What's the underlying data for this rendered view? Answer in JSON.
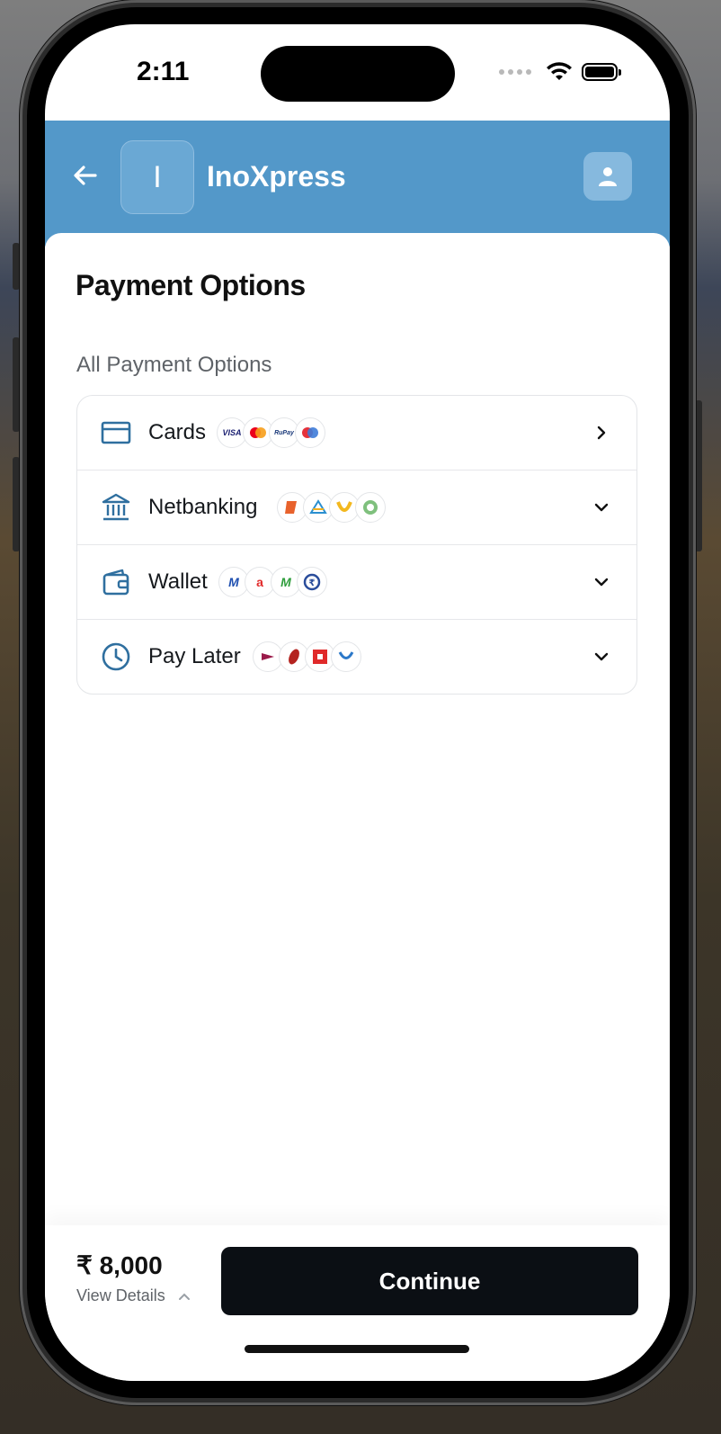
{
  "status_bar": {
    "time": "2:11"
  },
  "header": {
    "logo_letter": "I",
    "brand": "InoXpress"
  },
  "page": {
    "title": "Payment Options",
    "section_label": "All Payment Options"
  },
  "payment_options": [
    {
      "label": "Cards",
      "icon": "credit-card-icon",
      "chevron": "chevron-right-icon",
      "logos": [
        "VISA",
        "Mastercard",
        "RuPay",
        "Maestro"
      ]
    },
    {
      "label": "Netbanking",
      "icon": "bank-icon",
      "chevron": "chevron-down-icon",
      "logos": [
        "bank-logo-1",
        "bank-logo-2",
        "bank-logo-3",
        "bank-logo-4"
      ]
    },
    {
      "label": "Wallet",
      "icon": "wallet-icon",
      "chevron": "chevron-down-icon",
      "logos": [
        "wallet-logo-1",
        "wallet-logo-2",
        "wallet-logo-3",
        "wallet-logo-4"
      ]
    },
    {
      "label": "Pay Later",
      "icon": "clock-icon",
      "chevron": "chevron-down-icon",
      "logos": [
        "paylater-logo-1",
        "paylater-logo-2",
        "paylater-logo-3",
        "paylater-logo-4"
      ]
    }
  ],
  "footer": {
    "amount": "₹ 8,000",
    "view_details": "View Details",
    "continue_label": "Continue"
  },
  "colors": {
    "header": "#5398c9",
    "icon": "#2f6f9f",
    "button": "#0b0f14"
  }
}
